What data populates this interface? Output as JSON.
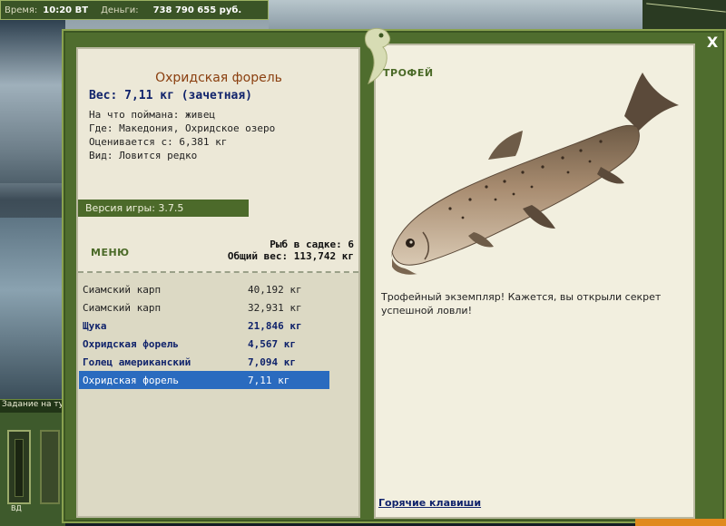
{
  "status": {
    "time_label": "Время:",
    "time_value": "10:20 ВТ",
    "money_label": "Деньги:",
    "money_value": "738 790 655 руб."
  },
  "background": {
    "task_label": "Задание на тур"
  },
  "gauge_label": "ВД",
  "close_label": "X",
  "fish": {
    "title": "Охридская форель",
    "weight": "Вес: 7,11 кг (зачетная)",
    "bait": "На что поймана: живец",
    "where": "Где: Македония, Охридское озеро",
    "valued": "Оценивается с: 6,381 кг",
    "kind": "Вид: Ловится редко"
  },
  "version": "Версия игры: 3.7.5",
  "menu_label": "МЕНЮ",
  "keepnet": {
    "count": "Рыб в садке: 6",
    "total": "Общий вес: 113,742 кг"
  },
  "catches": [
    {
      "name": "Сиамский карп",
      "weight": "40,192 кг",
      "bold": false,
      "selected": false
    },
    {
      "name": "Сиамский карп",
      "weight": "32,931 кг",
      "bold": false,
      "selected": false
    },
    {
      "name": "Щука",
      "weight": "21,846 кг",
      "bold": true,
      "selected": false
    },
    {
      "name": "Охридская форель",
      "weight": "4,567 кг",
      "bold": true,
      "selected": false
    },
    {
      "name": "Голец американский",
      "weight": "7,094 кг",
      "bold": true,
      "selected": false
    },
    {
      "name": "Охридская форель",
      "weight": "7,11 кг",
      "bold": false,
      "selected": true
    }
  ],
  "trophy_label": "ТРОФЕЙ",
  "trophy_text": "Трофейный экземпляр! Кажется, вы открыли секрет успешной ловли!",
  "hotkeys_label": "Горячие клавиши",
  "colors": {
    "panel_green": "#4f6d2e",
    "title_brown": "#8a3f0f",
    "label_navy": "#10236b",
    "selection_blue": "#2a6bbf"
  }
}
